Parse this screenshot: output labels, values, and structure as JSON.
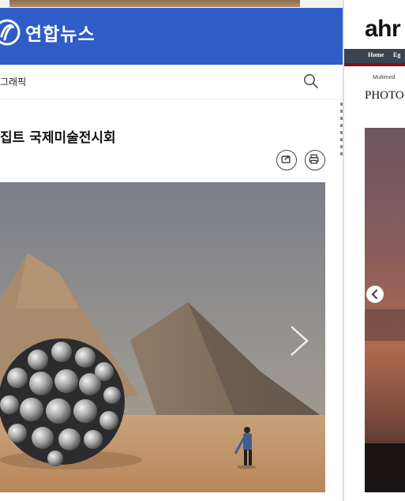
{
  "yonhap": {
    "brand": "연합뉴스",
    "section": "그래픽",
    "article_title": "집트 국제미술전시회",
    "icons": {
      "search": "search-icon",
      "share": "share-icon",
      "print": "print-icon",
      "next": "chevron-right-icon",
      "logo": "yonhap-logo-icon"
    },
    "colors": {
      "header": "#2f5cc6"
    }
  },
  "ahram": {
    "logo": "ahr",
    "nav": {
      "home": "Home",
      "egypt": "Eg"
    },
    "breadcrumb": "Multimed",
    "section": "PHOTO",
    "icons": {
      "prev": "chevron-left-icon"
    },
    "colors": {
      "nav": "#3a4350",
      "accent": "#7a1212"
    }
  }
}
